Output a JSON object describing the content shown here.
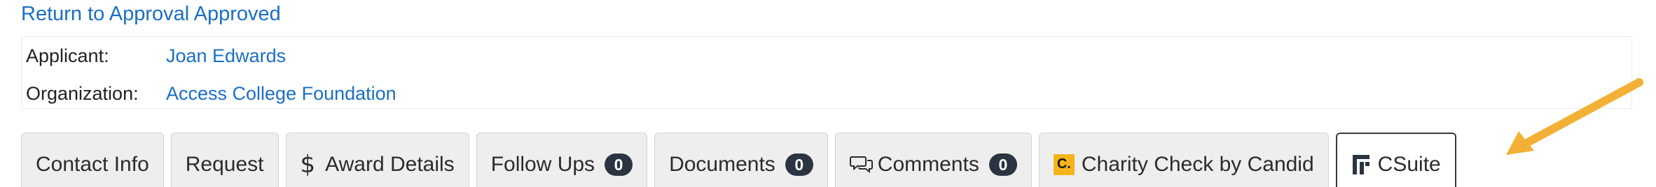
{
  "return_link": "Return to Approval Approved",
  "info": {
    "applicant_label": "Applicant:",
    "applicant_value": "Joan Edwards",
    "organization_label": "Organization:",
    "organization_value": "Access College Foundation"
  },
  "tabs": [
    {
      "label": "Contact Info"
    },
    {
      "label": "Request"
    },
    {
      "label": "Award Details",
      "icon": "dollar-icon"
    },
    {
      "label": "Follow Ups",
      "badge": "0"
    },
    {
      "label": "Documents",
      "badge": "0"
    },
    {
      "label": "Comments",
      "badge": "0",
      "icon": "comments-icon"
    },
    {
      "label": "Charity Check by Candid",
      "icon": "candid-logo-icon",
      "icon_text": "C."
    },
    {
      "label": "CSuite",
      "icon": "csuite-logo-icon",
      "active": true
    }
  ],
  "colors": {
    "link": "#1a6fc2",
    "badge": "#2b3440",
    "arrow": "#f2b136",
    "tab_bg": "#eeeeee"
  }
}
